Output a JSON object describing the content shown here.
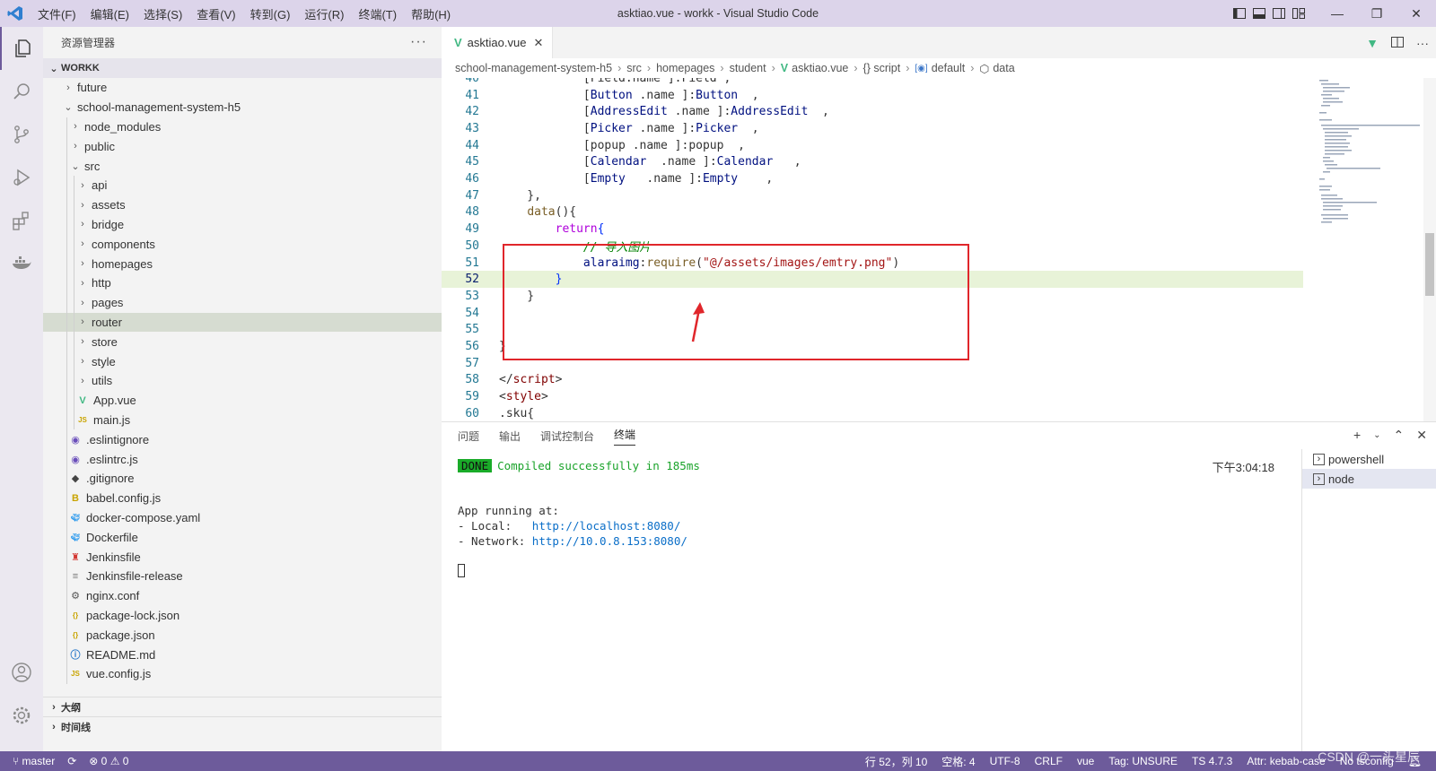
{
  "titlebar": {
    "title": "asktiao.vue - workk - Visual Studio Code",
    "menu": [
      "文件(F)",
      "编辑(E)",
      "选择(S)",
      "查看(V)",
      "转到(G)",
      "运行(R)",
      "终端(T)",
      "帮助(H)"
    ]
  },
  "sidebar": {
    "header": "资源管理器",
    "more": "···",
    "section": "WORKK",
    "tree": [
      {
        "label": "future",
        "kind": "folder",
        "depth": 0
      },
      {
        "label": "school-management-system-h5",
        "kind": "folder-open",
        "depth": 0
      },
      {
        "label": "node_modules",
        "kind": "folder",
        "depth": 1
      },
      {
        "label": "public",
        "kind": "folder",
        "depth": 1
      },
      {
        "label": "src",
        "kind": "folder-open",
        "depth": 1
      },
      {
        "label": "api",
        "kind": "folder",
        "depth": 2
      },
      {
        "label": "assets",
        "kind": "folder",
        "depth": 2
      },
      {
        "label": "bridge",
        "kind": "folder",
        "depth": 2
      },
      {
        "label": "components",
        "kind": "folder",
        "depth": 2
      },
      {
        "label": "homepages",
        "kind": "folder",
        "depth": 2
      },
      {
        "label": "http",
        "kind": "folder",
        "depth": 2
      },
      {
        "label": "pages",
        "kind": "folder",
        "depth": 2
      },
      {
        "label": "router",
        "kind": "folder",
        "depth": 2,
        "selected": true
      },
      {
        "label": "store",
        "kind": "folder",
        "depth": 2
      },
      {
        "label": "style",
        "kind": "folder",
        "depth": 2
      },
      {
        "label": "utils",
        "kind": "folder",
        "depth": 2
      },
      {
        "label": "App.vue",
        "kind": "vue",
        "depth": 2
      },
      {
        "label": "main.js",
        "kind": "js",
        "depth": 2
      },
      {
        "label": ".eslintignore",
        "kind": "eslint",
        "depth": 1
      },
      {
        "label": ".eslintrc.js",
        "kind": "eslint",
        "depth": 1
      },
      {
        "label": ".gitignore",
        "kind": "git",
        "depth": 1
      },
      {
        "label": "babel.config.js",
        "kind": "babel",
        "depth": 1
      },
      {
        "label": "docker-compose.yaml",
        "kind": "docker",
        "depth": 1
      },
      {
        "label": "Dockerfile",
        "kind": "docker",
        "depth": 1
      },
      {
        "label": "Jenkinsfile",
        "kind": "jenkins",
        "depth": 1
      },
      {
        "label": "Jenkinsfile-release",
        "kind": "text",
        "depth": 1
      },
      {
        "label": "nginx.conf",
        "kind": "gear",
        "depth": 1
      },
      {
        "label": "package-lock.json",
        "kind": "json",
        "depth": 1
      },
      {
        "label": "package.json",
        "kind": "json",
        "depth": 1
      },
      {
        "label": "README.md",
        "kind": "info",
        "depth": 1
      },
      {
        "label": "vue.config.js",
        "kind": "js",
        "depth": 1
      }
    ],
    "outline": "大纲",
    "timeline": "时间线"
  },
  "editor": {
    "tab": {
      "label": "asktiao.vue",
      "close": "✕"
    },
    "breadcrumb": [
      "school-management-system-h5",
      "src",
      "homepages",
      "student",
      "asktiao.vue",
      "{} script",
      "default",
      "data"
    ],
    "lines": [
      {
        "n": "40",
        "parts": [
          {
            "t": "            [Field.name ]:Field ,",
            "c": "k-punct"
          }
        ]
      },
      {
        "n": "41",
        "parts": [
          {
            "t": "            [",
            "c": "k-punct"
          },
          {
            "t": "Button",
            "c": "k-key"
          },
          {
            "t": " .name ]:",
            "c": "k-punct"
          },
          {
            "t": "Button",
            "c": "k-key"
          },
          {
            "t": "  ,",
            "c": "k-punct"
          }
        ]
      },
      {
        "n": "42",
        "parts": [
          {
            "t": "            [",
            "c": "k-punct"
          },
          {
            "t": "AddressEdit",
            "c": "k-key"
          },
          {
            "t": " .name ]:",
            "c": "k-punct"
          },
          {
            "t": "AddressEdit",
            "c": "k-key"
          },
          {
            "t": "  ,",
            "c": "k-punct"
          }
        ]
      },
      {
        "n": "43",
        "parts": [
          {
            "t": "            [",
            "c": "k-punct"
          },
          {
            "t": "Picker",
            "c": "k-key"
          },
          {
            "t": " .name ]:",
            "c": "k-punct"
          },
          {
            "t": "Picker",
            "c": "k-key"
          },
          {
            "t": "  ,",
            "c": "k-punct"
          }
        ]
      },
      {
        "n": "44",
        "parts": [
          {
            "t": "            [popup .name ]:popup  ,",
            "c": "k-punct"
          }
        ]
      },
      {
        "n": "45",
        "parts": [
          {
            "t": "            [",
            "c": "k-punct"
          },
          {
            "t": "Calendar",
            "c": "k-key"
          },
          {
            "t": "  .name ]:",
            "c": "k-punct"
          },
          {
            "t": "Calendar",
            "c": "k-key"
          },
          {
            "t": "   ,",
            "c": "k-punct"
          }
        ]
      },
      {
        "n": "46",
        "parts": [
          {
            "t": "            [",
            "c": "k-punct"
          },
          {
            "t": "Empty",
            "c": "k-key"
          },
          {
            "t": "   .name ]:",
            "c": "k-punct"
          },
          {
            "t": "Empty",
            "c": "k-key"
          },
          {
            "t": "    ,",
            "c": "k-punct"
          }
        ]
      },
      {
        "n": "47",
        "parts": [
          {
            "t": "    },",
            "c": "k-punct"
          }
        ]
      },
      {
        "n": "48",
        "parts": [
          {
            "t": "    ",
            "c": "k-punct"
          },
          {
            "t": "data",
            "c": "k-fn"
          },
          {
            "t": "(){",
            "c": "k-punct"
          }
        ]
      },
      {
        "n": "49",
        "parts": [
          {
            "t": "        ",
            "c": "k-punct"
          },
          {
            "t": "return",
            "c": "k-ret"
          },
          {
            "t": "{",
            "c": "k-br"
          }
        ]
      },
      {
        "n": "50",
        "parts": [
          {
            "t": "            ",
            "c": "k-punct"
          },
          {
            "t": "// 导入图片",
            "c": "k-cmt"
          }
        ]
      },
      {
        "n": "51",
        "parts": [
          {
            "t": "            ",
            "c": "k-punct"
          },
          {
            "t": "alaraimg",
            "c": "k-key"
          },
          {
            "t": ":",
            "c": "k-punct"
          },
          {
            "t": "require",
            "c": "k-fn"
          },
          {
            "t": "(",
            "c": "k-punct"
          },
          {
            "t": "\"@/assets/images/emtry.png\"",
            "c": "k-str"
          },
          {
            "t": ")",
            "c": "k-punct"
          }
        ]
      },
      {
        "n": "52",
        "parts": [
          {
            "t": "        ",
            "c": "k-punct"
          },
          {
            "t": "}",
            "c": "k-br"
          }
        ],
        "highlight": true
      },
      {
        "n": "53",
        "parts": [
          {
            "t": "    }",
            "c": "k-punct"
          }
        ]
      },
      {
        "n": "54",
        "parts": [
          {
            "t": "",
            "c": "k-punct"
          }
        ]
      },
      {
        "n": "55",
        "parts": [
          {
            "t": "",
            "c": "k-punct"
          }
        ]
      },
      {
        "n": "56",
        "parts": [
          {
            "t": "}",
            "c": "k-punct"
          }
        ]
      },
      {
        "n": "57",
        "parts": [
          {
            "t": "",
            "c": "k-punct"
          }
        ]
      },
      {
        "n": "58",
        "parts": [
          {
            "t": "</",
            "c": "k-punct"
          },
          {
            "t": "script",
            "c": "k-tag"
          },
          {
            "t": ">",
            "c": "k-punct"
          }
        ]
      },
      {
        "n": "59",
        "parts": [
          {
            "t": "<",
            "c": "k-punct"
          },
          {
            "t": "style",
            "c": "k-tag"
          },
          {
            "t": ">",
            "c": "k-punct"
          }
        ]
      },
      {
        "n": "60",
        "parts": [
          {
            "t": ".sku{",
            "c": "k-punct"
          }
        ]
      }
    ]
  },
  "panel": {
    "tabs": [
      "问题",
      "输出",
      "调试控制台",
      "终端"
    ],
    "active_tab": "终端",
    "done_badge": "DONE",
    "compiled": "Compiled successfully in 185ms",
    "time": "下午3:04:18",
    "app_running": "App running at:",
    "local_label": "- Local:   ",
    "local_url": "http://localhost:8080/",
    "network_label": "- Network: ",
    "network_url": "http://10.0.8.153:8080/",
    "terminals": [
      "powershell",
      "node"
    ]
  },
  "statusbar": {
    "branch": "master",
    "problems": "⊗ 0 ⚠ 0",
    "position": "行 52，列 10",
    "spaces": "空格: 4",
    "encoding": "UTF-8",
    "eol": "CRLF",
    "language": "vue",
    "tag": "Tag: UNSURE",
    "ts": "TS 4.7.3",
    "attr": "Attr: kebab-case",
    "tsconfig": "No tsconfig"
  },
  "watermark": "CSDN @一头星辰",
  "colors": {
    "accent": "#6d5b9b",
    "annotation": "#e0262b"
  }
}
